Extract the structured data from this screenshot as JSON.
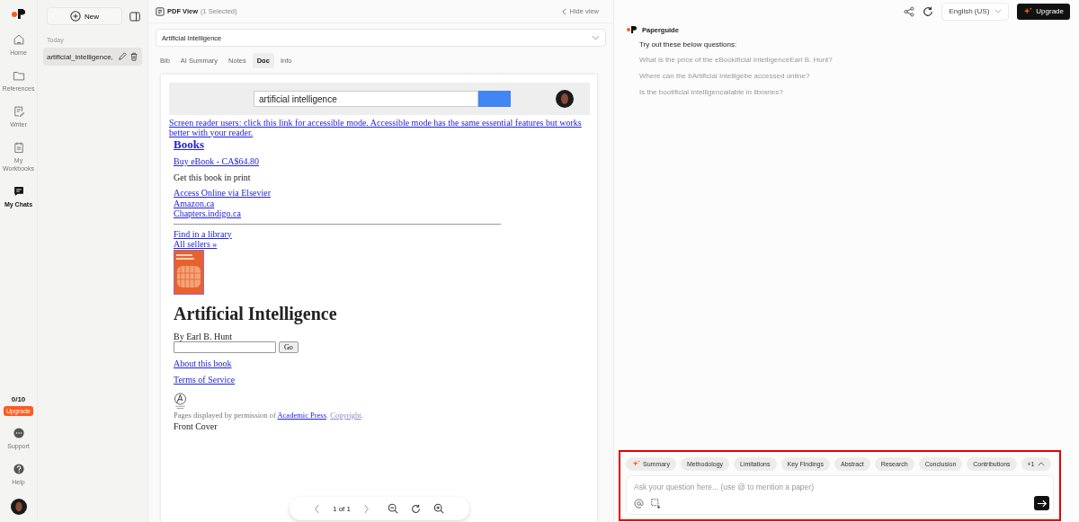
{
  "rail": {
    "items": [
      {
        "kind": "home",
        "label": "Home",
        "selected": false
      },
      {
        "kind": "folder",
        "label": "References",
        "selected": false
      },
      {
        "kind": "writer",
        "label": "Writer",
        "selected": false
      },
      {
        "kind": "calendar",
        "label": "My Workbooks",
        "selected": false
      },
      {
        "kind": "chat",
        "label": "My Chats",
        "selected": true
      }
    ],
    "quota": "0/10",
    "upgrade": "Upgrade",
    "bottom": [
      {
        "kind": "support",
        "label": "Support"
      },
      {
        "kind": "help",
        "label": "Help"
      }
    ]
  },
  "sidebar": {
    "new_button": "New",
    "group": "Today",
    "chats": [
      {
        "title": "artificial_intelligence,",
        "selected": true
      }
    ]
  },
  "pdf_view": {
    "title": "PDF View",
    "count": "(1 Selected)",
    "hide": "Hide view",
    "document_select": "Artificial Intelligence",
    "tabs": [
      {
        "label": "Bib",
        "selected": false
      },
      {
        "label": "AI Summary",
        "selected": false
      },
      {
        "label": "Notes",
        "selected": false
      },
      {
        "label": "Doc",
        "selected": true
      },
      {
        "label": "Info",
        "selected": false
      }
    ],
    "doc": {
      "search_value": "artificial intelligence",
      "alt_link": "Screen reader users: click this link for accessible mode. Accessible mode has the same essential features but works better with your reader.",
      "heading": "Books",
      "buy": "Buy eBook - CA$64.80",
      "print_label": "Get this book in print",
      "print_links": [
        "Access Online via Elsevier",
        "Amazon.ca",
        "Chapters.indigo.ca"
      ],
      "more_links": [
        "Find in a library",
        "All sellers »"
      ],
      "title": "Artificial Intelligence",
      "author": "By Earl B. Hunt",
      "go": "Go",
      "links": [
        "About this book",
        "Terms of Service"
      ],
      "permission": "Pages displayed by permission of",
      "publisher": "Academic Press",
      "copyright": "Copyright",
      "stop": ".",
      "cover_label": "Front Cover"
    },
    "pager": "1 of 1"
  },
  "chat": {
    "language": "English (US)",
    "upgrade": "Upgrade",
    "bot": "Paperguide",
    "intro": "Try out these below questions:",
    "questions": [
      "What is the price of the eBookificial IntelligenceEarl B. Hunt?",
      "Where can the bArtificial Intelligebe accessed online?",
      "Is the bootificial Intelligencailable in libraries?"
    ],
    "chips": [
      {
        "label": "Summary",
        "kind": "spark"
      },
      {
        "label": "Methodology",
        "kind": "plain"
      },
      {
        "label": "Limitations",
        "kind": "plain"
      },
      {
        "label": "Key Findings",
        "kind": "plain"
      },
      {
        "label": "Abstract",
        "kind": "plain"
      },
      {
        "label": "Research",
        "kind": "plain"
      },
      {
        "label": "Conclusion",
        "kind": "plain"
      },
      {
        "label": "Contributions",
        "kind": "plain"
      },
      {
        "label": "+1",
        "kind": "more"
      }
    ],
    "placeholder": "Ask your question here... (use @ to mention a paper)"
  }
}
